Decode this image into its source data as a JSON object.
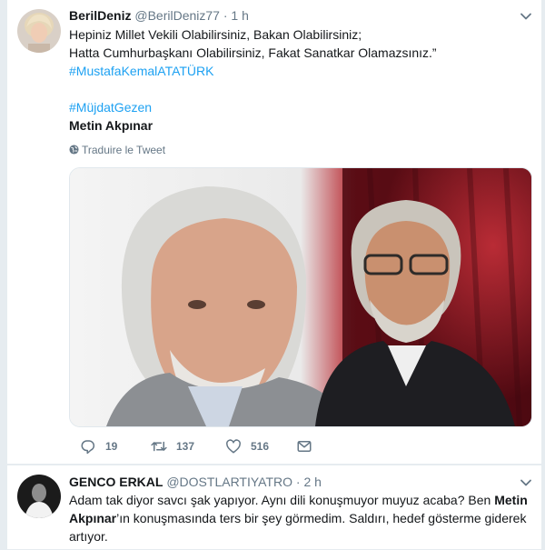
{
  "tweets": [
    {
      "display_name": "BerilDeniz",
      "handle": "@BerilDeniz77",
      "separator": "·",
      "time": "1 h",
      "line1": "Hepiniz Millet Vekili Olabilirsiniz, Bakan Olabilirsiniz;",
      "line2": "Hatta Cumhurbaşkanı Olabilirsiniz, Fakat Sanatkar Olamazsınız.”",
      "hashtag1": "#MustafaKemalATATÜRK",
      "hashtag2": "#MüjdatGezen",
      "bold_line": "Metin Akpınar",
      "translate_label": "Traduire le Tweet",
      "reply_count": "19",
      "retweet_count": "137",
      "like_count": "516"
    },
    {
      "display_name": "GENCO ERKAL",
      "handle": "@DOSTLARTIYATRO",
      "separator": "·",
      "time": "2 h",
      "text_1": "Adam tak diyor savcı şak yapıyor. Aynı dili konuşmuyor muyuz acaba? Ben ",
      "bold_1": "Metin",
      "bold_2": "Akpınar",
      "text_2": "’ın konuşmasında ters bir şey görmedim. Saldırı, hedef gösterme giderek",
      "text_3": "artıyor."
    }
  ],
  "colors": {
    "link": "#1da1f2",
    "muted": "#657786",
    "text": "#14171a",
    "background": "#e6ecf0"
  },
  "icons": [
    "chevron-down-icon",
    "globe-icon",
    "reply-icon",
    "retweet-icon",
    "like-icon",
    "message-icon"
  ]
}
